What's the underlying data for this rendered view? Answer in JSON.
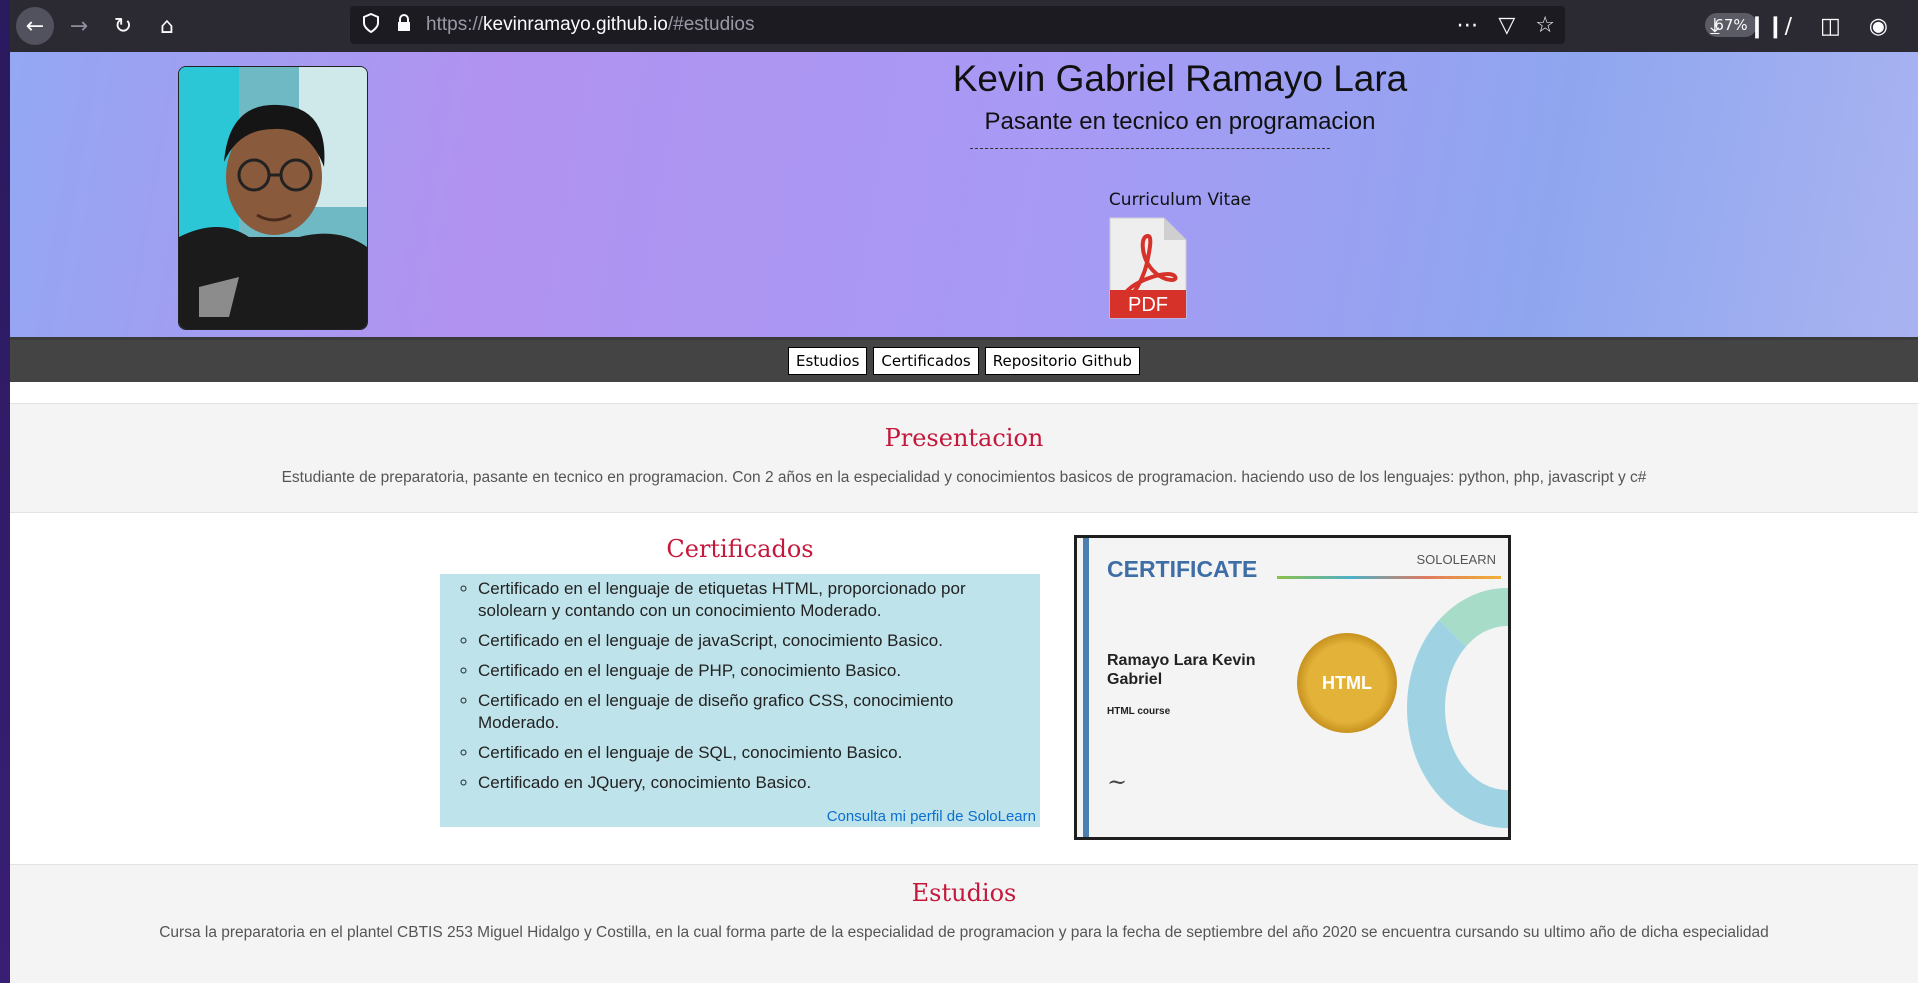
{
  "browser": {
    "url_scheme": "https://",
    "url_host": "kevinramayo.github.io",
    "url_rest": "/#estudios",
    "zoom": "67%"
  },
  "hero": {
    "name": "Kevin Gabriel Ramayo Lara",
    "subtitle": "Pasante en tecnico en programacion",
    "cv_label": "Curriculum Vitae",
    "pdf_label": "PDF"
  },
  "nav": {
    "items": [
      "Estudios",
      "Certificados",
      "Repositorio Github"
    ]
  },
  "presentacion": {
    "title": "Presentacion",
    "text": "Estudiante de preparatoria, pasante en tecnico en programacion. Con 2 años en la especialidad y conocimientos basicos de programacion. haciendo uso de los lenguajes: python, php, javascript y c#"
  },
  "certificados": {
    "title": "Certificados",
    "items": [
      "Certificado en el lenguaje de etiquetas HTML, proporcionado por sololearn y contando con un conocimiento Moderado.",
      "Certificado en el lenguaje de javaScript, conocimiento Basico.",
      "Certificado en el lenguaje de PHP, conocimiento Basico.",
      "Certificado en el lenguaje de diseño grafico CSS, conocimiento Moderado.",
      "Certificado en el lenguaje de SQL, conocimiento Basico.",
      "Certificado en JQuery, conocimiento Basico."
    ],
    "link": "Consulta mi perfil de SoloLearn"
  },
  "certificate_image": {
    "heading": "CERTIFICATE",
    "brand": "SOLOLEARN",
    "recipient": "Ramayo Lara Kevin Gabriel",
    "course": "HTML course",
    "seal": "HTML"
  },
  "estudios": {
    "title": "Estudios",
    "text": "Cursa la preparatoria en el plantel CBTIS 253 Miguel Hidalgo y Costilla, en la cual forma parte de la especialidad de programacion y para la fecha de septiembre del año 2020 se encuentra cursando su ultimo año de dicha especialidad"
  }
}
